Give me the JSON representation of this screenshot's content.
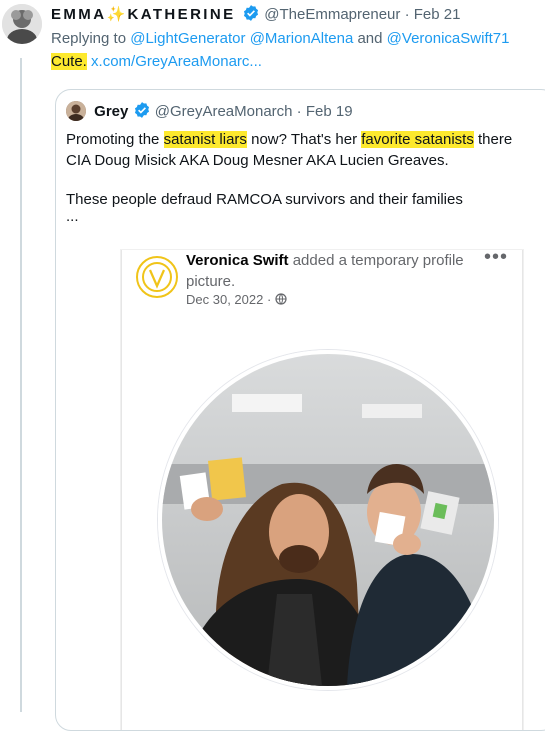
{
  "tweet": {
    "display_name_part1": "EMMA",
    "sparkle": "✨",
    "display_name_part2": "KATHERINE",
    "handle": "@TheEmmapreneur",
    "separator": "·",
    "date": "Feb 21",
    "replying_prefix": "Replying to",
    "reply_mention_1": "@LightGenerator",
    "reply_mention_2": "@MarionAltena",
    "reply_and": "and",
    "reply_mention_3": "@VeronicaSwift71",
    "text_highlight": "Cute.",
    "text_link": "x.com/GreyAreaMonarc..."
  },
  "quote": {
    "name": "Grey",
    "handle": "@GreyAreaMonarch",
    "separator": "·",
    "date": "Feb 19",
    "line1_a": "Promoting the ",
    "line1_hl1": "satanist liars",
    "line1_b": " now? That's her ",
    "line1_hl2": "favorite satanists",
    "line1_c": " there",
    "line2": "CIA Doug Misick AKA Doug Mesner AKA Lucien Greaves.",
    "line3": "These people defraud RAMCOA survivors and their families",
    "line4": "..."
  },
  "embed": {
    "name": "Veronica Swift",
    "action": " added a temporary profile picture.",
    "date": "Dec 30, 2022",
    "separator": "·",
    "globe_icon": "globe-icon",
    "more": "•••"
  },
  "colors": {
    "highlight": "#fde92e",
    "link": "#1d9bf0",
    "muted": "#536471",
    "verified": "#1d9bf0"
  }
}
